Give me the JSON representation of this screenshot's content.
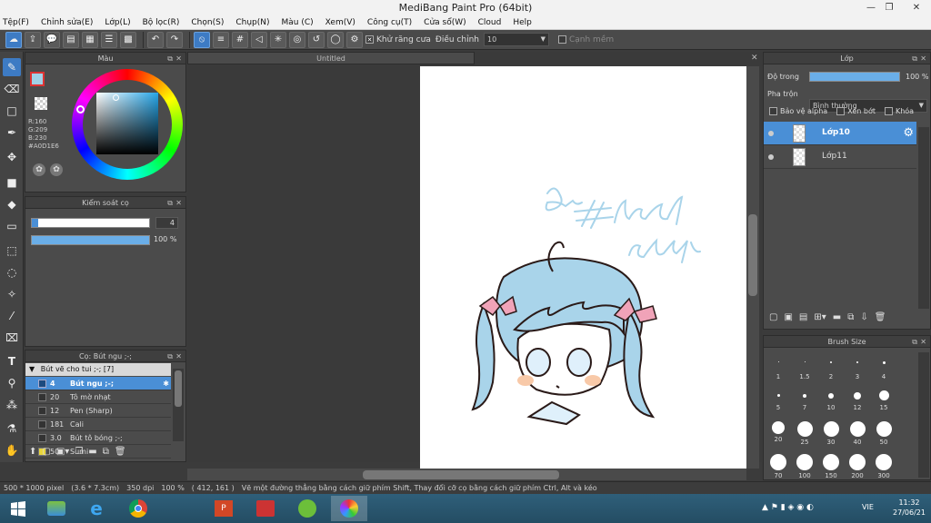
{
  "window": {
    "title": "MediBang Paint Pro (64bit)"
  },
  "menu": [
    "Tệp(F)",
    "Chỉnh sửa(E)",
    "Lớp(L)",
    "Bộ lọc(R)",
    "Chọn(S)",
    "Chụp(N)",
    "Màu (C)",
    "Xem(V)",
    "Công cụ(T)",
    "Cửa sổ(W)",
    "Cloud",
    "Help"
  ],
  "toolbar": {
    "antialias_label": "Khử răng cưa",
    "adjust_label": "Điều chỉnh",
    "adjust_value": "10",
    "edge_label": "Cạnh mềm"
  },
  "color_panel": {
    "title": "Màu",
    "r": "R:160",
    "g": "G:209",
    "b": "B:230",
    "hex": "#A0D1E6",
    "current_color": "#A0D1E6"
  },
  "brush_control": {
    "title": "Kiểm soát cọ",
    "size": "4",
    "opacity": "100 %"
  },
  "brush_panel": {
    "title": "Cọ: Bút ngu ;-;",
    "group": "Bút vẽ cho tui ;-; [7]",
    "items": [
      {
        "num": "4",
        "name": "Bút ngu ;-;"
      },
      {
        "num": "20",
        "name": "Tô mờ nhạt"
      },
      {
        "num": "12",
        "name": "Pen (Sharp)"
      },
      {
        "num": "181",
        "name": "Cali"
      },
      {
        "num": "3.0",
        "name": "Bút tô bóng ;-;"
      },
      {
        "num": "50",
        "name": "Sumi"
      }
    ]
  },
  "canvas": {
    "tab": "Untitled"
  },
  "layer_panel": {
    "title": "Lớp",
    "opacity_label": "Độ trong",
    "opacity_value": "100 %",
    "blend_label": "Pha trộn",
    "blend_value": "Bình thường",
    "protect_alpha": "Bảo vệ alpha",
    "clipping": "Xén bớt",
    "lock": "Khóa",
    "layers": [
      "Lớp10",
      "Lớp11"
    ]
  },
  "brush_size_panel": {
    "title": "Brush Size",
    "sizes": [
      "1",
      "1.5",
      "2",
      "3",
      "4",
      "5",
      "7",
      "10",
      "12",
      "15",
      "20",
      "25",
      "30",
      "40",
      "50",
      "70",
      "100",
      "150",
      "200",
      "300"
    ]
  },
  "status": {
    "dimensions": "500 * 1000 pixel",
    "physical": "(3.6 * 7.3cm)",
    "dpi": "350 dpi",
    "zoom": "100 %",
    "cursor": "( 412, 161 )",
    "hint": "Vẽ một đường thẳng bằng cách giữ phím Shift, Thay đổi cỡ cọ bằng cách giữ phím Ctrl, Alt và kéo"
  },
  "taskbar": {
    "lang": "VIE",
    "time": "11:32",
    "date": "27/06/21"
  },
  "colors": {
    "accent": "#4a8fd6",
    "hair": "#a9d4ea",
    "bow": "#f0a3b8"
  }
}
